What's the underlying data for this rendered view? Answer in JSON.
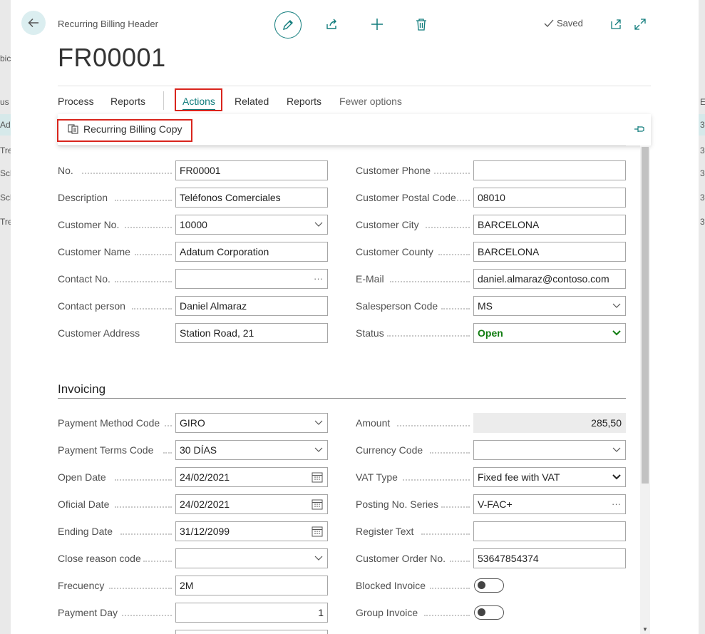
{
  "header": {
    "caption": "Recurring Billing Header",
    "title": "FR00001",
    "saved_label": "Saved"
  },
  "menu": {
    "items": [
      "Process",
      "Reports",
      "Actions",
      "Related",
      "Reports",
      "Fewer options"
    ]
  },
  "actions": {
    "recurring_billing_copy": "Recurring Billing Copy"
  },
  "general": {
    "left": [
      {
        "label": "No.",
        "value": "FR00001"
      },
      {
        "label": "Description",
        "value": "Teléfonos Comerciales"
      },
      {
        "label": "Customer No.",
        "value": "10000"
      },
      {
        "label": "Customer Name",
        "value": "Adatum Corporation"
      },
      {
        "label": "Contact No.",
        "value": ""
      },
      {
        "label": "Contact person",
        "value": "Daniel Almaraz"
      },
      {
        "label": "Customer Address",
        "value": "Station Road, 21"
      }
    ],
    "right": [
      {
        "label": "Customer Phone",
        "value": ""
      },
      {
        "label": "Customer Postal Code",
        "value": "08010"
      },
      {
        "label": "Customer City",
        "value": "BARCELONA"
      },
      {
        "label": "Customer County",
        "value": "BARCELONA"
      },
      {
        "label": "E-Mail",
        "value": "daniel.almaraz@contoso.com"
      },
      {
        "label": "Salesperson Code",
        "value": "MS"
      },
      {
        "label": "Status",
        "value": "Open"
      }
    ]
  },
  "invoicing": {
    "title": "Invoicing",
    "left": [
      {
        "label": "Payment Method Code",
        "value": "GIRO"
      },
      {
        "label": "Payment Terms Code",
        "value": "30 DÍAS"
      },
      {
        "label": "Open Date",
        "value": "24/02/2021"
      },
      {
        "label": "Oficial Date",
        "value": "24/02/2021"
      },
      {
        "label": "Ending Date",
        "value": "31/12/2099"
      },
      {
        "label": "Close reason code",
        "value": ""
      },
      {
        "label": "Frecuency",
        "value": "2M"
      },
      {
        "label": "Payment Day",
        "value": "1"
      }
    ],
    "right": [
      {
        "label": "Amount",
        "value": "285,50"
      },
      {
        "label": "Currency Code",
        "value": ""
      },
      {
        "label": "VAT Type",
        "value": "Fixed fee with VAT"
      },
      {
        "label": "Posting No. Series",
        "value": "V-FAC+"
      },
      {
        "label": "Register Text",
        "value": ""
      },
      {
        "label": "Customer Order No.",
        "value": "53647854374"
      },
      {
        "label": "Blocked Invoice",
        "value": ""
      },
      {
        "label": "Group Invoice",
        "value": ""
      }
    ]
  },
  "background": {
    "left_fragments": [
      "bic",
      "us",
      "Ada",
      "Tre",
      "Sch",
      "Sch",
      "Tre"
    ],
    "right_fragments": [
      "E",
      "3",
      "3",
      "3",
      "3",
      "3"
    ]
  },
  "colors": {
    "accent": "#107c7c",
    "highlight": "#d9251d",
    "status_open": "#107c10"
  }
}
